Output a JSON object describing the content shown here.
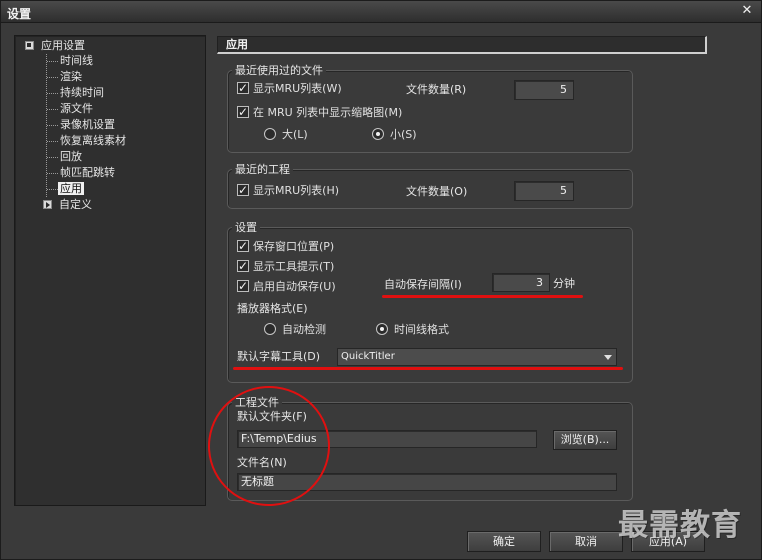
{
  "window": {
    "title": "设置",
    "close_glyph": "✕"
  },
  "tree": {
    "root_label": "应用设置",
    "children": [
      "时间线",
      "渲染",
      "持续时间",
      "源文件",
      "录像机设置",
      "恢复离线素材",
      "回放",
      "帧匹配跳转",
      "应用"
    ],
    "selected": "应用",
    "custom_label": "自定义"
  },
  "panel": {
    "title": "应用"
  },
  "recent_files": {
    "legend": "最近使用过的文件",
    "show_mru": "显示MRU列表(W)",
    "count_label": "文件数量(R)",
    "count_value": "5",
    "show_thumbs": "在 MRU 列表中显示缩略图(M)",
    "size_large": "大(L)",
    "size_small": "小(S)",
    "selected_size": "small"
  },
  "recent_projects": {
    "legend": "最近的工程",
    "show_mru": "显示MRU列表(H)",
    "count_label": "文件数量(O)",
    "count_value": "5"
  },
  "settings": {
    "legend": "设置",
    "save_window_pos": "保存窗口位置(P)",
    "show_tooltips": "显示工具提示(T)",
    "enable_autosave": "启用自动保存(U)",
    "autosave_interval_label": "自动保存间隔(I)",
    "autosave_interval_value": "3",
    "autosave_unit": "分钟",
    "player_format_label": "播放器格式(E)",
    "auto_detect": "自动检测",
    "timeline_format": "时间线格式",
    "selected_format": "timeline",
    "default_titler_label": "默认字幕工具(D)",
    "default_titler_value": "QuickTitler"
  },
  "project_file": {
    "legend": "工程文件",
    "default_folder_label": "默认文件夹(F)",
    "default_folder_value": "F:\\Temp\\Edius",
    "browse_label": "浏览(B)...",
    "filename_label": "文件名(N)",
    "filename_value": "无标题"
  },
  "footer": {
    "ok": "确定",
    "cancel": "取消",
    "apply": "应用(A)"
  },
  "watermark": "最需教育",
  "colors": {
    "annotation": "#e01010",
    "background": "#3a3a3a"
  }
}
